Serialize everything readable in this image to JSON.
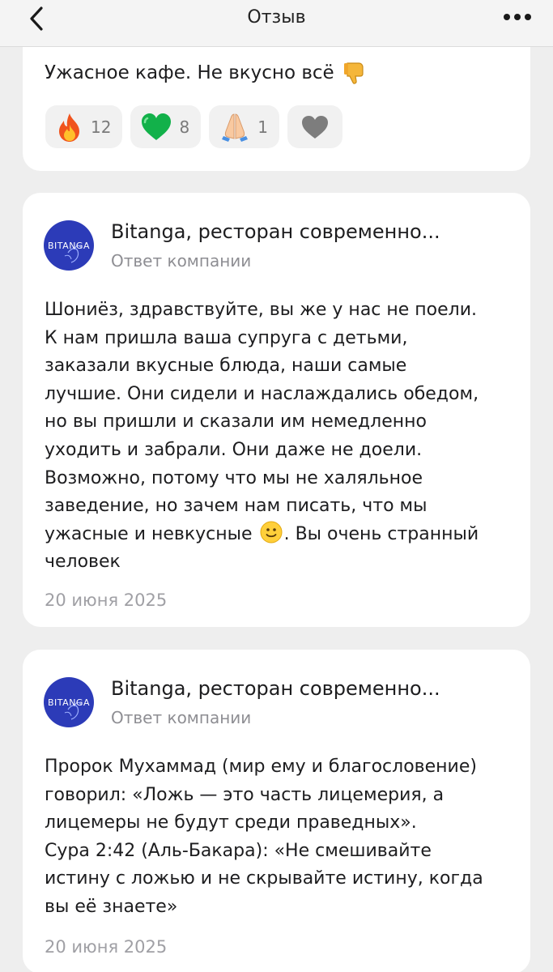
{
  "header": {
    "title": "Отзыв",
    "back_icon": "chevron-left-icon",
    "more_icon": "ellipsis-icon"
  },
  "review": {
    "text": "Ужасное кафе. Не вкусно всё",
    "emoji": "thumbs-down-icon",
    "reactions": [
      {
        "icon": "fire-icon",
        "count": "12"
      },
      {
        "icon": "green-heart-icon",
        "count": "8"
      },
      {
        "icon": "praying-hands-icon",
        "count": "1"
      },
      {
        "icon": "heart-icon",
        "count": ""
      }
    ]
  },
  "replies": [
    {
      "company_name": "Bitanga, ресторан современно...",
      "subtitle": "Ответ компании",
      "avatar_text": "BITANGA",
      "lines": [
        "Шониёз, здравствуйте, вы же у нас не поели.",
        "К нам пришла ваша супруга с детьми,",
        "заказали вкусные блюда, наши самые",
        "лучшие. Они сидели и наслаждались обедом,",
        "но вы пришли и сказали им немедленно",
        "уходить и забрали. Они даже не доели.",
        "Возможно, потому что мы не халяльное",
        "заведение, но зачем нам писать, что мы",
        "ужасные и невкусные",
        "человек"
      ],
      "line9_suffix": ". Вы очень странный",
      "date": "20 июня 2025"
    },
    {
      "company_name": "Bitanga, ресторан современно...",
      "subtitle": "Ответ компании",
      "avatar_text": "BITANGA",
      "lines": [
        "Пророк Мухаммад (мир ему и благословение)",
        "говорил: «Ложь — это часть лицемерия, а",
        "лицемеры не будут среди праведных».",
        "Сура 2:42 (Аль-Бакара): «Не смешивайте",
        "истину с ложью и не скрывайте истину, когда",
        "вы её знаете»"
      ],
      "date": "20 июня 2025"
    }
  ],
  "colors": {
    "avatar_bg": "#2c3bb8",
    "card_bg": "#ffffff",
    "page_bg": "#eeeeee",
    "muted": "#8e8e93"
  }
}
